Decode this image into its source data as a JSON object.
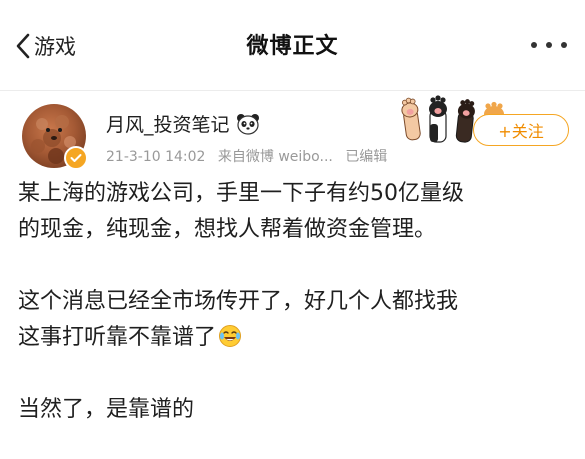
{
  "nav": {
    "back_label": "游戏",
    "title": "微博正文"
  },
  "post": {
    "author": "月风_投资笔记",
    "timestamp": "21-3-10 14:02",
    "source": "来自微博 weibo...",
    "edited": "已编辑",
    "follow_label": "+关注",
    "paragraphs": [
      [
        "某上海的游戏公司，手里一下子有约50亿量级",
        "的现金，纯现金，想找人帮着做资金管理。"
      ],
      [
        "这个消息已经全市场传开了，好几个人都找我",
        "这事打听靠不靠谱了"
      ],
      [
        "当然了，是靠谱的"
      ]
    ]
  },
  "colors": {
    "accent": "#f5a623",
    "follow_text": "#f08c00",
    "meta_text": "#999999"
  },
  "icons": {
    "back": "chevron-left-icon",
    "more": "more-dots-icon",
    "verified": "verified-badge-icon",
    "panda": "panda-emoji-icon",
    "laugh_cry": "laugh-cry-emoji-icon",
    "paws": "cat-paws-decoration"
  }
}
